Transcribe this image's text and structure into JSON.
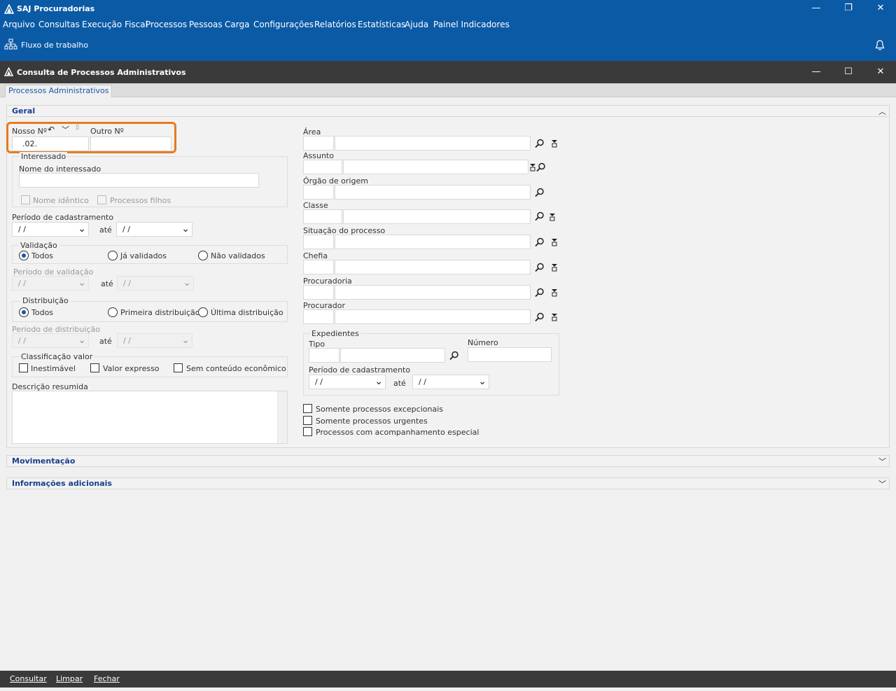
{
  "app": {
    "title": "SAJ Procuradorias"
  },
  "menu": [
    "Arquivo",
    "Consultas",
    "Execução Fiscal",
    "Processos",
    "Pessoas",
    "Carga",
    "Configurações",
    "Relatórios",
    "Estatísticas",
    "Ajuda",
    "Painel Indicadores"
  ],
  "toolbar": {
    "workflow_label": "Fluxo de trabalho"
  },
  "window": {
    "title": "Consulta de Processos Administrativos"
  },
  "tabs": [
    "Processos Administrativos"
  ],
  "sections": {
    "geral": "Geral",
    "movimentacao": "Movimentação",
    "informacoes": "Informações adicionais"
  },
  "form": {
    "nosso_no_label": "Nosso Nº",
    "nosso_no_value": ".02.",
    "outro_no_label": "Outro Nº",
    "outro_no_value": "",
    "interessado_group": "Interessado",
    "nome_interessado_label": "Nome do interessado",
    "nome_identico": "Nome idêntico",
    "processos_filhos": "Processos filhos",
    "periodo_cadastramento": "Período de cadastramento",
    "ate": "até",
    "date_placeholder": "/ /",
    "validacao_group": "Validação",
    "validacao_options": [
      "Todos",
      "Já validados",
      "Não validados"
    ],
    "periodo_validacao": "Período de validação",
    "distribuicao_group": "Distribuição",
    "distribuicao_options": [
      "Todos",
      "Primeira distribuição",
      "Última distribuição"
    ],
    "periodo_distribuicao": "Período de distribuição",
    "classificacao_group": "Classificação valor",
    "classificacao_options": [
      "Inestimável",
      "Valor expresso",
      "Sem conteúdo econômico"
    ],
    "descricao_resumida": "Descrição resumida",
    "area": "Área",
    "assunto": "Assunto",
    "orgao_origem": "Órgão de origem",
    "classe": "Classe",
    "situacao": "Situação do processo",
    "chefia": "Chefia",
    "procuradoria": "Procuradoria",
    "procurador": "Procurador",
    "expedientes_group": "Expedientes",
    "tipo": "Tipo",
    "numero": "Número",
    "exp_periodo": "Período de cadastramento",
    "somente_excepcionais": "Somente processos excepcionais",
    "somente_urgentes": "Somente processos urgentes",
    "acompanhamento_especial": "Processos com acompanhamento especial"
  },
  "actions": {
    "consultar": "Consultar",
    "limpar": "Limpar",
    "fechar": "Fechar"
  }
}
